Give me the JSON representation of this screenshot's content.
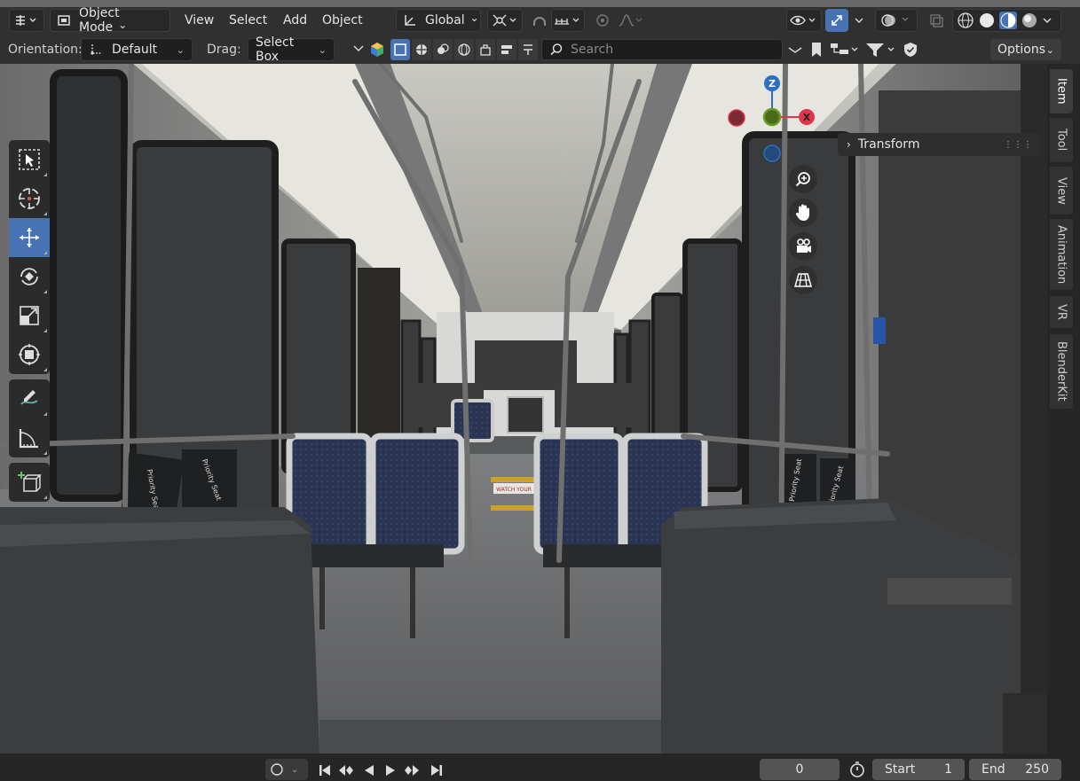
{
  "header": {
    "editor_type_icon": "editor-type-icon",
    "mode": "Object Mode",
    "menus": [
      "View",
      "Select",
      "Add",
      "Object"
    ],
    "transform_orientation": "Global",
    "pivot_icon": "pivot-point-icon",
    "snap_icon": "snap-icon",
    "proportional_icon": "proportional-editing-icon",
    "shading_modes": [
      "wireframe",
      "solid",
      "material-preview",
      "rendered"
    ],
    "active_shading": "material-preview"
  },
  "tool_header": {
    "orientation_label": "Orientation:",
    "orientation_value": "Default",
    "drag_label": "Drag:",
    "drag_value": "Select Box",
    "search_placeholder": "Search",
    "options_label": "Options"
  },
  "toolbar": {
    "tools": [
      "select-box",
      "cursor",
      "move",
      "rotate",
      "scale",
      "transform",
      "annotate",
      "measure",
      "add-cube"
    ],
    "active_tool": "move"
  },
  "gizmo": {
    "axes": [
      "Z",
      "X"
    ]
  },
  "sidebar": {
    "panel_title": "Transform",
    "tabs": [
      "Item",
      "Tool",
      "View",
      "Animation",
      "VR",
      "BlenderKit"
    ],
    "active_tab": "Item"
  },
  "scene": {
    "sign_left_1": "Priority Seat",
    "sign_left_2": "Priority Seat",
    "sign_right_1": "Priority Seat",
    "sign_right_2": "Priority Seat",
    "floor_text": "WATCH YOUR"
  },
  "timeline": {
    "current_frame": "0",
    "start_label": "Start",
    "start_value": "1",
    "end_label": "End",
    "end_value": "250"
  },
  "colors": {
    "accent": "#4772b3",
    "axis_x": "#e0344f",
    "axis_y": "#6b9b1e",
    "axis_z": "#2d6fc4"
  }
}
